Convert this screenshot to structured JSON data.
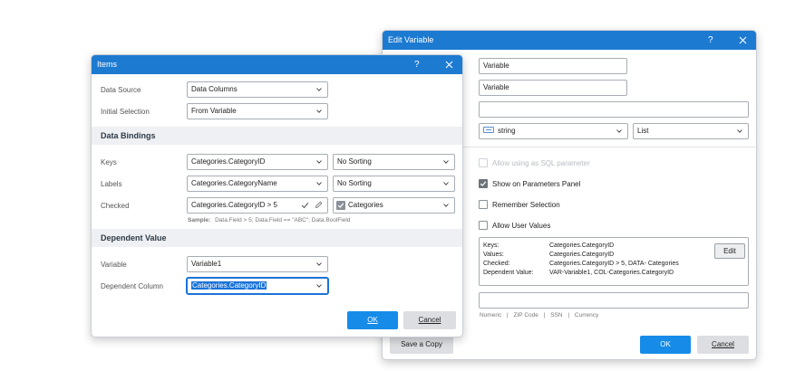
{
  "edit_variable": {
    "title": "Edit Variable",
    "help": "?",
    "name_value": "Variable",
    "alias_value": "Variable",
    "description_value": "",
    "type_value": "string",
    "type_icon": "string-type-icon",
    "kind_value": "List",
    "options": {
      "sql_parameter": "Allow using as SQL parameter",
      "show_on_panel": "Show on Parameters Panel",
      "remember_selection": "Remember Selection",
      "allow_user_values": "Allow User Values"
    },
    "summary": [
      {
        "key": "Keys:",
        "value": "Categories.CategoryID"
      },
      {
        "key": "Values:",
        "value": "Categories.CategoryID"
      },
      {
        "key": "Checked:",
        "value": "Categories.CategoryID > 5, DATA- Categories"
      },
      {
        "key": "Dependent Value:",
        "value": "VAR-Variable1, COL-Categories.CategoryID"
      }
    ],
    "edit_label": "Edit",
    "mask_value": "",
    "mask_hints": [
      "Numeric",
      "ZIP Code",
      "SSN",
      "Currency"
    ],
    "mask_sep": "|",
    "save_copy_label": "Save a Copy",
    "ok_label": "OK",
    "cancel_label": "Cancel"
  },
  "items": {
    "title": "Items",
    "help": "?",
    "data_source_label": "Data Source",
    "data_source_value": "Data Columns",
    "initial_selection_label": "Initial Selection",
    "initial_selection_value": "From Variable",
    "bindings_header": "Data Bindings",
    "keys_label": "Keys",
    "keys_value": "Categories.CategoryID",
    "keys_sort": "No Sorting",
    "labels_label": "Labels",
    "labels_value": "Categories.CategoryName",
    "labels_sort": "No Sorting",
    "checked_label": "Checked",
    "checked_value": "Categories.CategoryID > 5",
    "checked_column": "Categories",
    "sample_label": "Sample:",
    "sample_text": "Data.Field > 5; Data.Field == \"ABC\"; Data.BoolField",
    "dependent_header": "Dependent Value",
    "variable_label": "Variable",
    "variable_value": "Variable1",
    "dependent_column_label": "Dependent Column",
    "dependent_column_value": "Categories.CategoryID",
    "ok_label": "OK",
    "cancel_label": "Cancel"
  },
  "colors": {
    "titlebar": "#1d7ad1",
    "primary_button": "#168ce8",
    "selection": "#1a73d9"
  }
}
